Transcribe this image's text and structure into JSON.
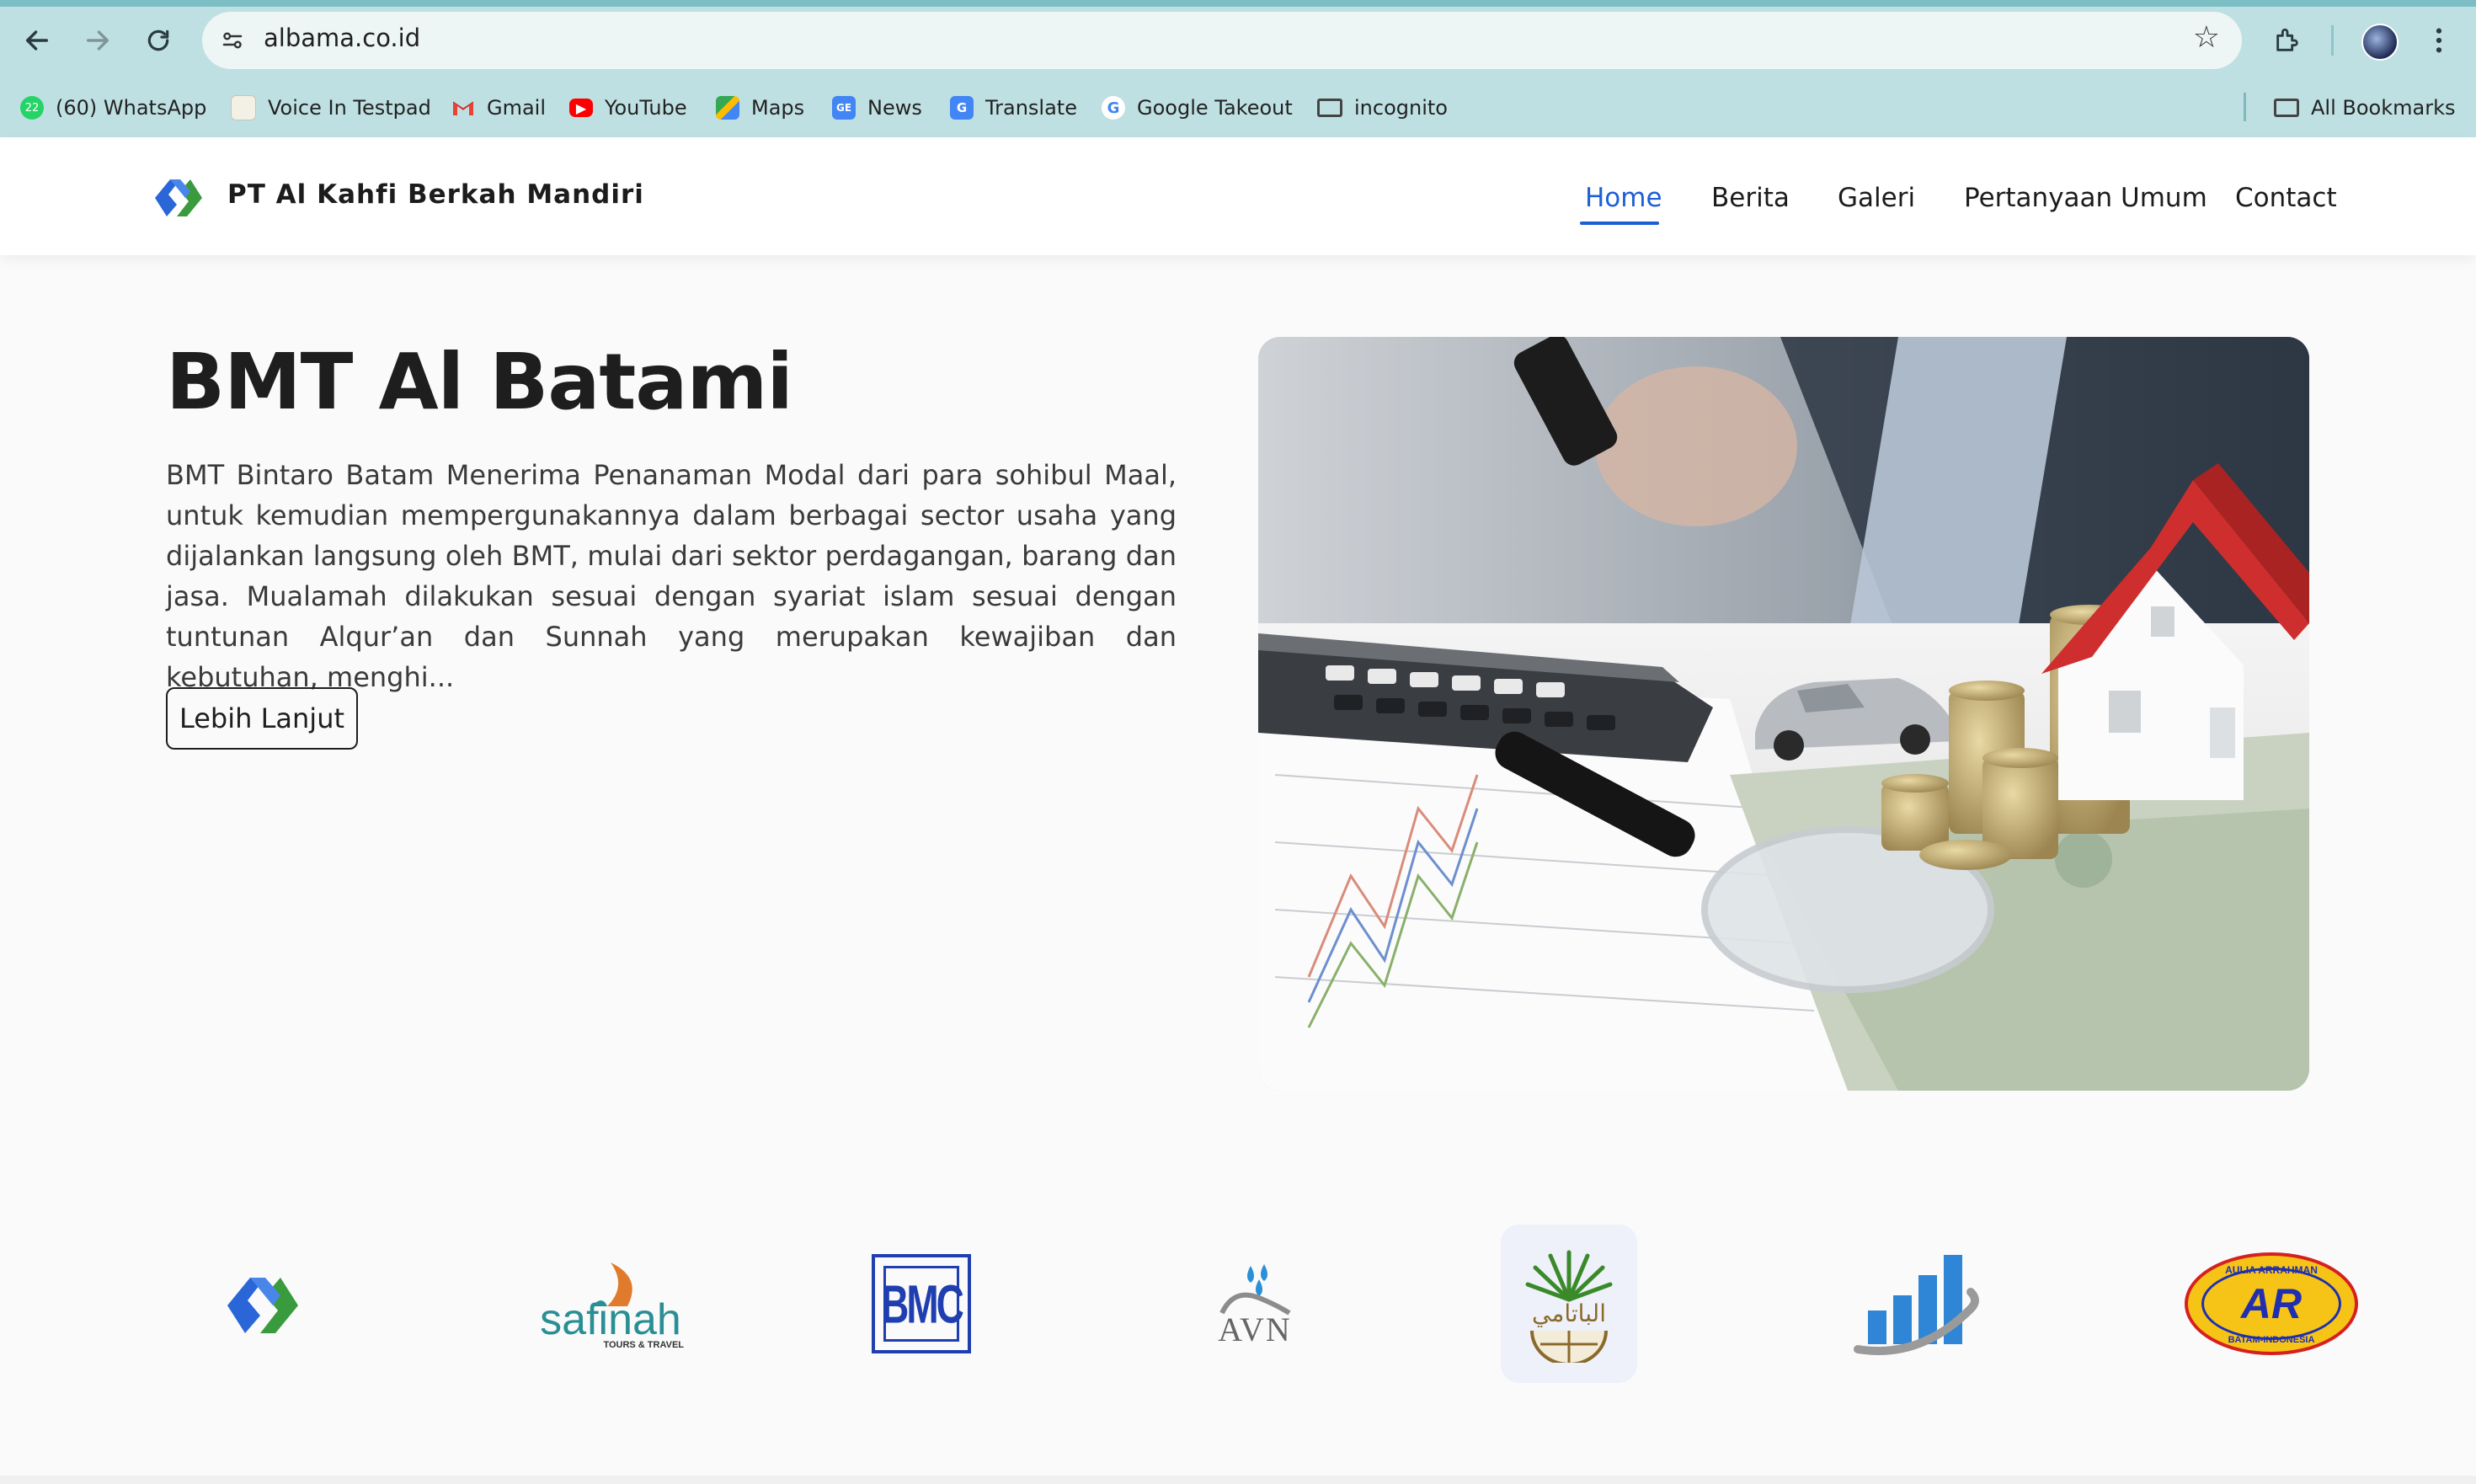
{
  "browser": {
    "url": "albama.co.id",
    "bookmarks": [
      {
        "label": "(60) WhatsApp",
        "icon": "whatsapp-icon",
        "badge": "60",
        "color": "#25d366"
      },
      {
        "label": "Voice In Testpad",
        "icon": "notepad-icon"
      },
      {
        "label": "Gmail",
        "icon": "gmail-icon"
      },
      {
        "label": "YouTube",
        "icon": "youtube-icon",
        "color": "#ff0000"
      },
      {
        "label": "Maps",
        "icon": "maps-icon"
      },
      {
        "label": "News",
        "icon": "news-icon"
      },
      {
        "label": "Translate",
        "icon": "translate-icon"
      },
      {
        "label": "Google Takeout",
        "icon": "google-icon"
      },
      {
        "label": "incognito",
        "icon": "folder-icon"
      }
    ],
    "all_bookmarks": "All Bookmarks"
  },
  "header": {
    "brand": "PT Al Kahfi Berkah Mandiri",
    "nav": [
      {
        "label": "Home",
        "active": true
      },
      {
        "label": "Berita"
      },
      {
        "label": "Galeri"
      },
      {
        "label": "Pertanyaan Umum"
      },
      {
        "label": "Contact"
      }
    ],
    "accent": "#1d5fd6"
  },
  "hero": {
    "title": "BMT Al Batami",
    "description": "BMT Bintaro Batam Menerima Penanaman Modal dari para sohibul Maal, untuk kemudian mempergunakannya dalam berbagai sector usaha yang dijalankan langsung oleh BMT, mulai dari sektor perdagangan, barang dan jasa. Mualamah dilakukan sesuai dengan syariat islam sesuai dengan tuntunan Alqur’an dan Sunnah yang merupakan kewajiban dan kebutuhan, menghi...",
    "button": "Lebih Lanjut"
  },
  "partners": {
    "safinah": {
      "name": "safinah",
      "tagline": "TOURS & TRAVEL"
    },
    "bmc": {
      "name": "BMC"
    },
    "avn": {
      "name": "AVN"
    },
    "albatami": {
      "name": "الباتامي"
    },
    "ar": {
      "name": "AR",
      "top": "AULIA ARRAHMAN",
      "bottom": "BATAM-INDONESIA"
    }
  }
}
